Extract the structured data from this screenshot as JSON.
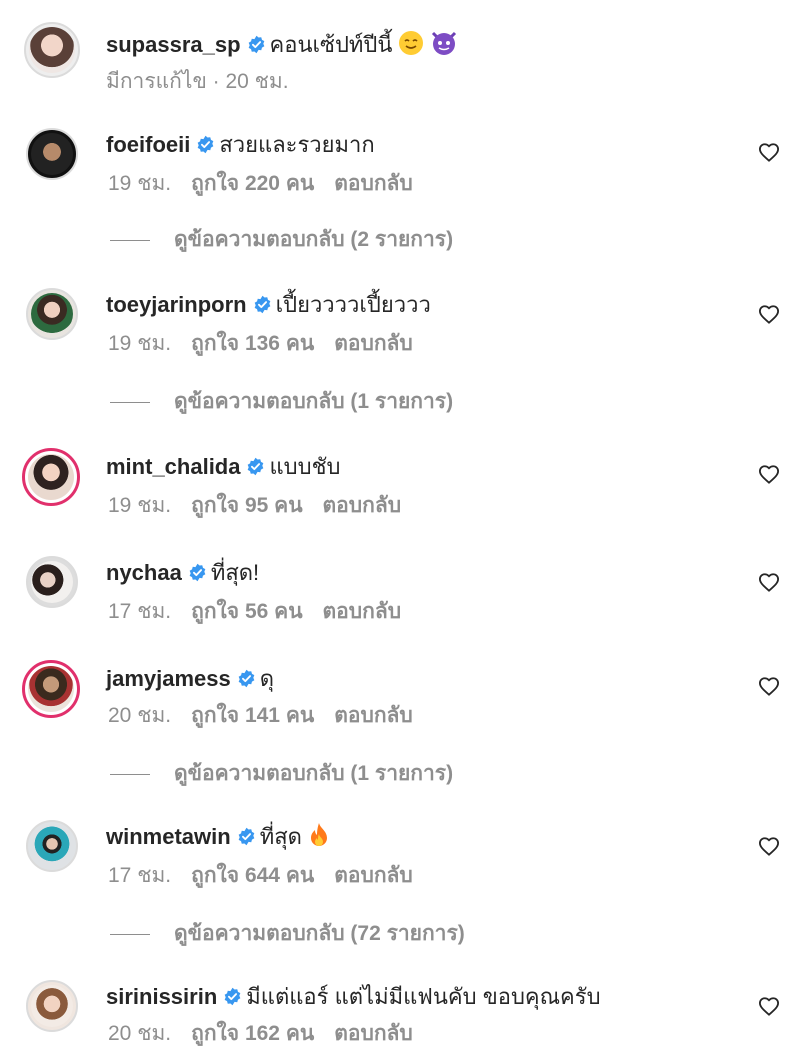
{
  "caption": {
    "username": "supassra_sp",
    "text": "คอนเซ้ปท์ปีนี้",
    "edited": "มีการแก้ไข · 20 ชม.",
    "emoji1": "smiling-face-icon",
    "emoji2": "smiling-devil-icon"
  },
  "comments": [
    {
      "username": "foeifoeii",
      "text": "สวยและรวยมาก",
      "time": "19 ชม.",
      "likes": "ถูกใจ 220 คน",
      "reply": "ตอบกลับ",
      "view_replies": "ดูข้อความตอบกลับ (2 รายการ)"
    },
    {
      "username": "toeyjarinporn",
      "text": "เปี้ยววววเปี้ยววว",
      "time": "19 ชม.",
      "likes": "ถูกใจ 136 คน",
      "reply": "ตอบกลับ",
      "view_replies": "ดูข้อความตอบกลับ (1 รายการ)"
    },
    {
      "username": "mint_chalida",
      "text": "แบบชับ",
      "time": "19 ชม.",
      "likes": "ถูกใจ 95 คน",
      "reply": "ตอบกลับ"
    },
    {
      "username": "nychaa",
      "text": "ที่สุด!",
      "time": "17 ชม.",
      "likes": "ถูกใจ 56 คน",
      "reply": "ตอบกลับ"
    },
    {
      "username": "jamyjamess",
      "text": "ดุ",
      "time": "20 ชม.",
      "likes": "ถูกใจ 141 คน",
      "reply": "ตอบกลับ",
      "view_replies": "ดูข้อความตอบกลับ (1 รายการ)"
    },
    {
      "username": "winmetawin",
      "text": "ที่สุด",
      "time": "17 ชม.",
      "likes": "ถูกใจ 644 คน",
      "reply": "ตอบกลับ",
      "view_replies": "ดูข้อความตอบกลับ (72 รายการ)"
    },
    {
      "username": "sirinissirin",
      "text": "มีแต่แอร์ แต่ไม่มีแฟนคับ ขอบคุณครับ",
      "time": "20 ชม.",
      "likes": "ถูกใจ 162 คน",
      "reply": "ตอบกลับ"
    }
  ],
  "colors": {
    "verified": "#3897f0",
    "meta": "#8e8e8e",
    "story_ring": "#d6249f"
  }
}
